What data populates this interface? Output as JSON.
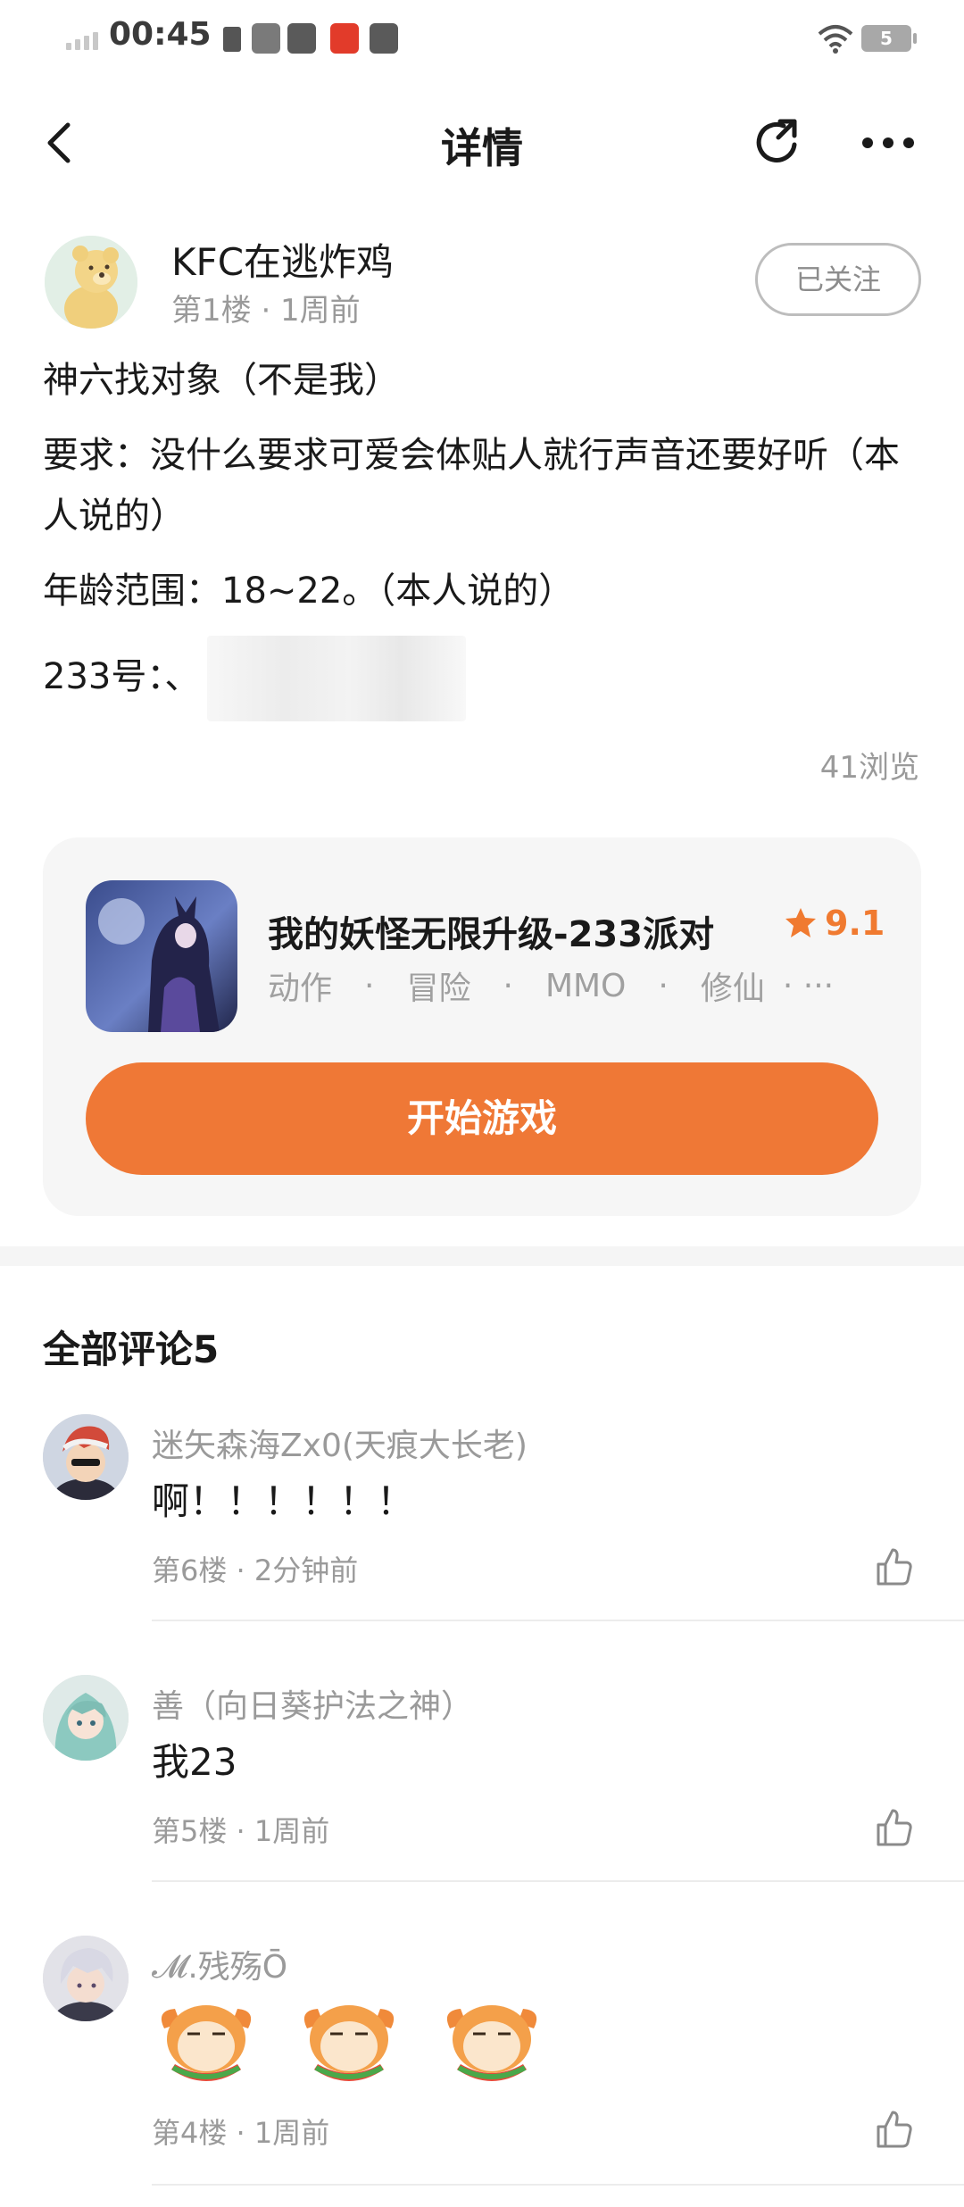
{
  "status_bar": {
    "time": "00:45",
    "battery": "5"
  },
  "nav": {
    "title": "详情"
  },
  "author": {
    "name": "KFC在逃炸鸡",
    "meta": "第1楼 · 1周前",
    "follow_label": "已关注"
  },
  "post": {
    "lines": [
      "神六找对象（不是我）",
      "要求：没什么要求可爱会体贴人就行声音还要好听（本人说的）",
      "年龄范围：18~22。（本人说的）"
    ],
    "id_label": "233号：、"
  },
  "views": "41浏览",
  "game": {
    "name": "我的妖怪无限升级-233派对",
    "rating": "9.1",
    "tags": [
      "动作",
      "冒险",
      "MMO",
      "修仙"
    ],
    "tags_more": "·  ···",
    "play_label": "开始游戏"
  },
  "comments": {
    "title": "全部评论5",
    "items": [
      {
        "name": "迷矢森海Zx0(天痕大长老)",
        "text": "啊！！！！！！",
        "meta": "第6楼 · 2分钟前"
      },
      {
        "name": "善（向日葵护法之神）",
        "text": "我23",
        "meta": "第5楼 · 1周前"
      },
      {
        "name": "𝓜.残殇Ō",
        "text": "",
        "meta": "第4楼 · 1周前"
      }
    ]
  },
  "colors": {
    "accent": "#ef7836",
    "star": "#f07a30",
    "muted_text": "#9a9a9a",
    "card_bg": "#f6f6f6"
  }
}
